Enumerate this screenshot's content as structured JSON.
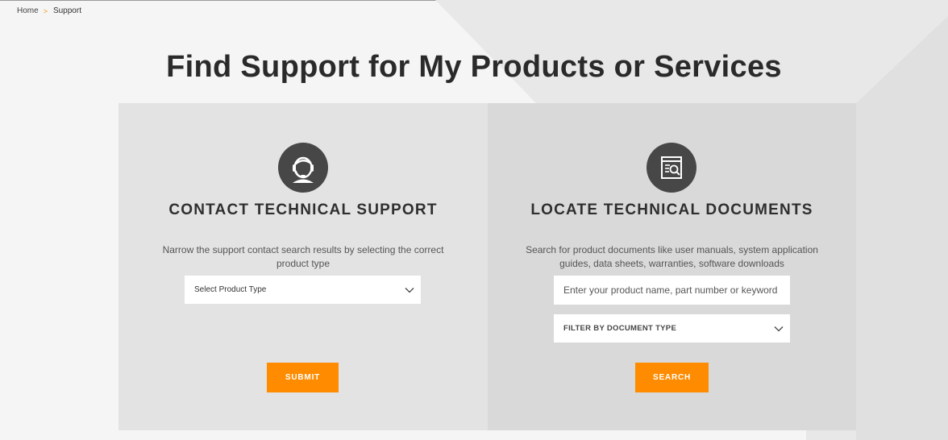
{
  "breadcrumb": {
    "home": "Home",
    "separator": ">",
    "current": "Support"
  },
  "page_title": "Find Support for My Products or Services",
  "contact_panel": {
    "icon": "headset-agent-icon",
    "heading": "CONTACT TECHNICAL SUPPORT",
    "description": "Narrow the support contact search results by selecting the correct product type",
    "select_value": "Select Product Type",
    "submit_label": "SUBMIT"
  },
  "documents_panel": {
    "icon": "document-search-icon",
    "heading": "LOCATE TECHNICAL DOCUMENTS",
    "description": "Search for product documents like user manuals, system application guides, data sheets, warranties, software downloads",
    "search_placeholder": "Enter your product name, part number or keyword",
    "filter_value": "FILTER BY DOCUMENT TYPE",
    "search_label": "SEARCH"
  },
  "colors": {
    "accent": "#ff8c00",
    "icon_bg": "#474747",
    "panel_left": "#e3e3e3",
    "panel_right": "#d9d9d9"
  }
}
